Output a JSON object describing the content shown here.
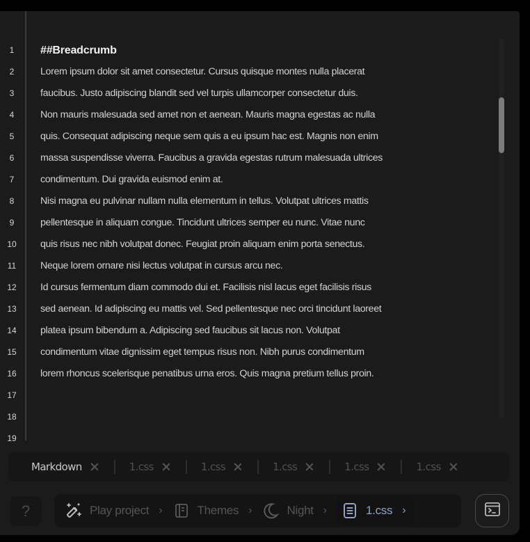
{
  "editor": {
    "line_numbers": [
      "1",
      "2",
      "3",
      "4",
      "5",
      "6",
      "7",
      "8",
      "9",
      "10",
      "11",
      "12",
      "13",
      "14",
      "15",
      "16",
      "17",
      "18",
      "19"
    ],
    "lines": [
      "##Breadcrumb",
      "Lorem ipsum dolor sit amet consectetur. Cursus quisque montes nulla placerat",
      "faucibus. Justo adipiscing blandit sed vel turpis ullamcorper consectetur duis.",
      "Non mauris malesuada sed amet non et aenean. Mauris magna egestas ac nulla",
      "quis. Consequat adipiscing neque sem quis a eu ipsum hac est. Magnis non enim",
      "massa suspendisse viverra. Faucibus a gravida egestas rutrum malesuada ultrices",
      "condimentum. Dui gravida euismod enim at.",
      "Nisi magna eu pulvinar nullam nulla elementum in tellus. Volutpat ultrices mattis",
      "pellentesque in aliquam congue. Tincidunt ultrices semper eu nunc. Vitae nunc",
      "quis risus nec nibh volutpat donec. Feugiat proin aliquam enim porta senectus.",
      "Neque lorem ornare nisi lectus volutpat in cursus arcu nec.",
      "Id cursus fermentum diam commodo dui et. Facilisis nisl lacus eget facilisis risus",
      "sed aenean. Id adipiscing eu mattis vel. Sed pellentesque nec orci tincidunt laoreet",
      "platea ipsum bibendum a. Adipiscing sed faucibus sit lacus non. Volutpat",
      "condimentum vitae dignissim eget tempus risus non. Nibh purus condimentum",
      "lorem rhoncus scelerisque penatibus urna eros. Quis magna pretium tellus proin.",
      "",
      "",
      ""
    ],
    "scroll_position_fraction": 0.18
  },
  "tabs": [
    {
      "label": "Markdown",
      "active": true,
      "close_icon": "close-icon"
    },
    {
      "label": "1.css",
      "active": false,
      "close_icon": "close-icon"
    },
    {
      "label": "1.css",
      "active": false,
      "close_icon": "close-icon"
    },
    {
      "label": "1.css",
      "active": false,
      "close_icon": "close-icon"
    },
    {
      "label": "1.css",
      "active": false,
      "close_icon": "close-icon"
    },
    {
      "label": "1.css",
      "active": false,
      "close_icon": "close-icon"
    }
  ],
  "bottom_bar": {
    "help_label": "?",
    "breadcrumb": [
      {
        "label": "Play project",
        "icon": "magic-wand-icon"
      },
      {
        "label": "Themes",
        "icon": "book-icon"
      },
      {
        "label": "Night",
        "icon": "moon-icon"
      },
      {
        "label": "1.css",
        "icon": "document-icon",
        "active": true
      }
    ],
    "separator": "›",
    "terminal_icon": "terminal-icon"
  },
  "colors": {
    "accent": "#8ea4c6",
    "background": "#1b1b1c"
  }
}
